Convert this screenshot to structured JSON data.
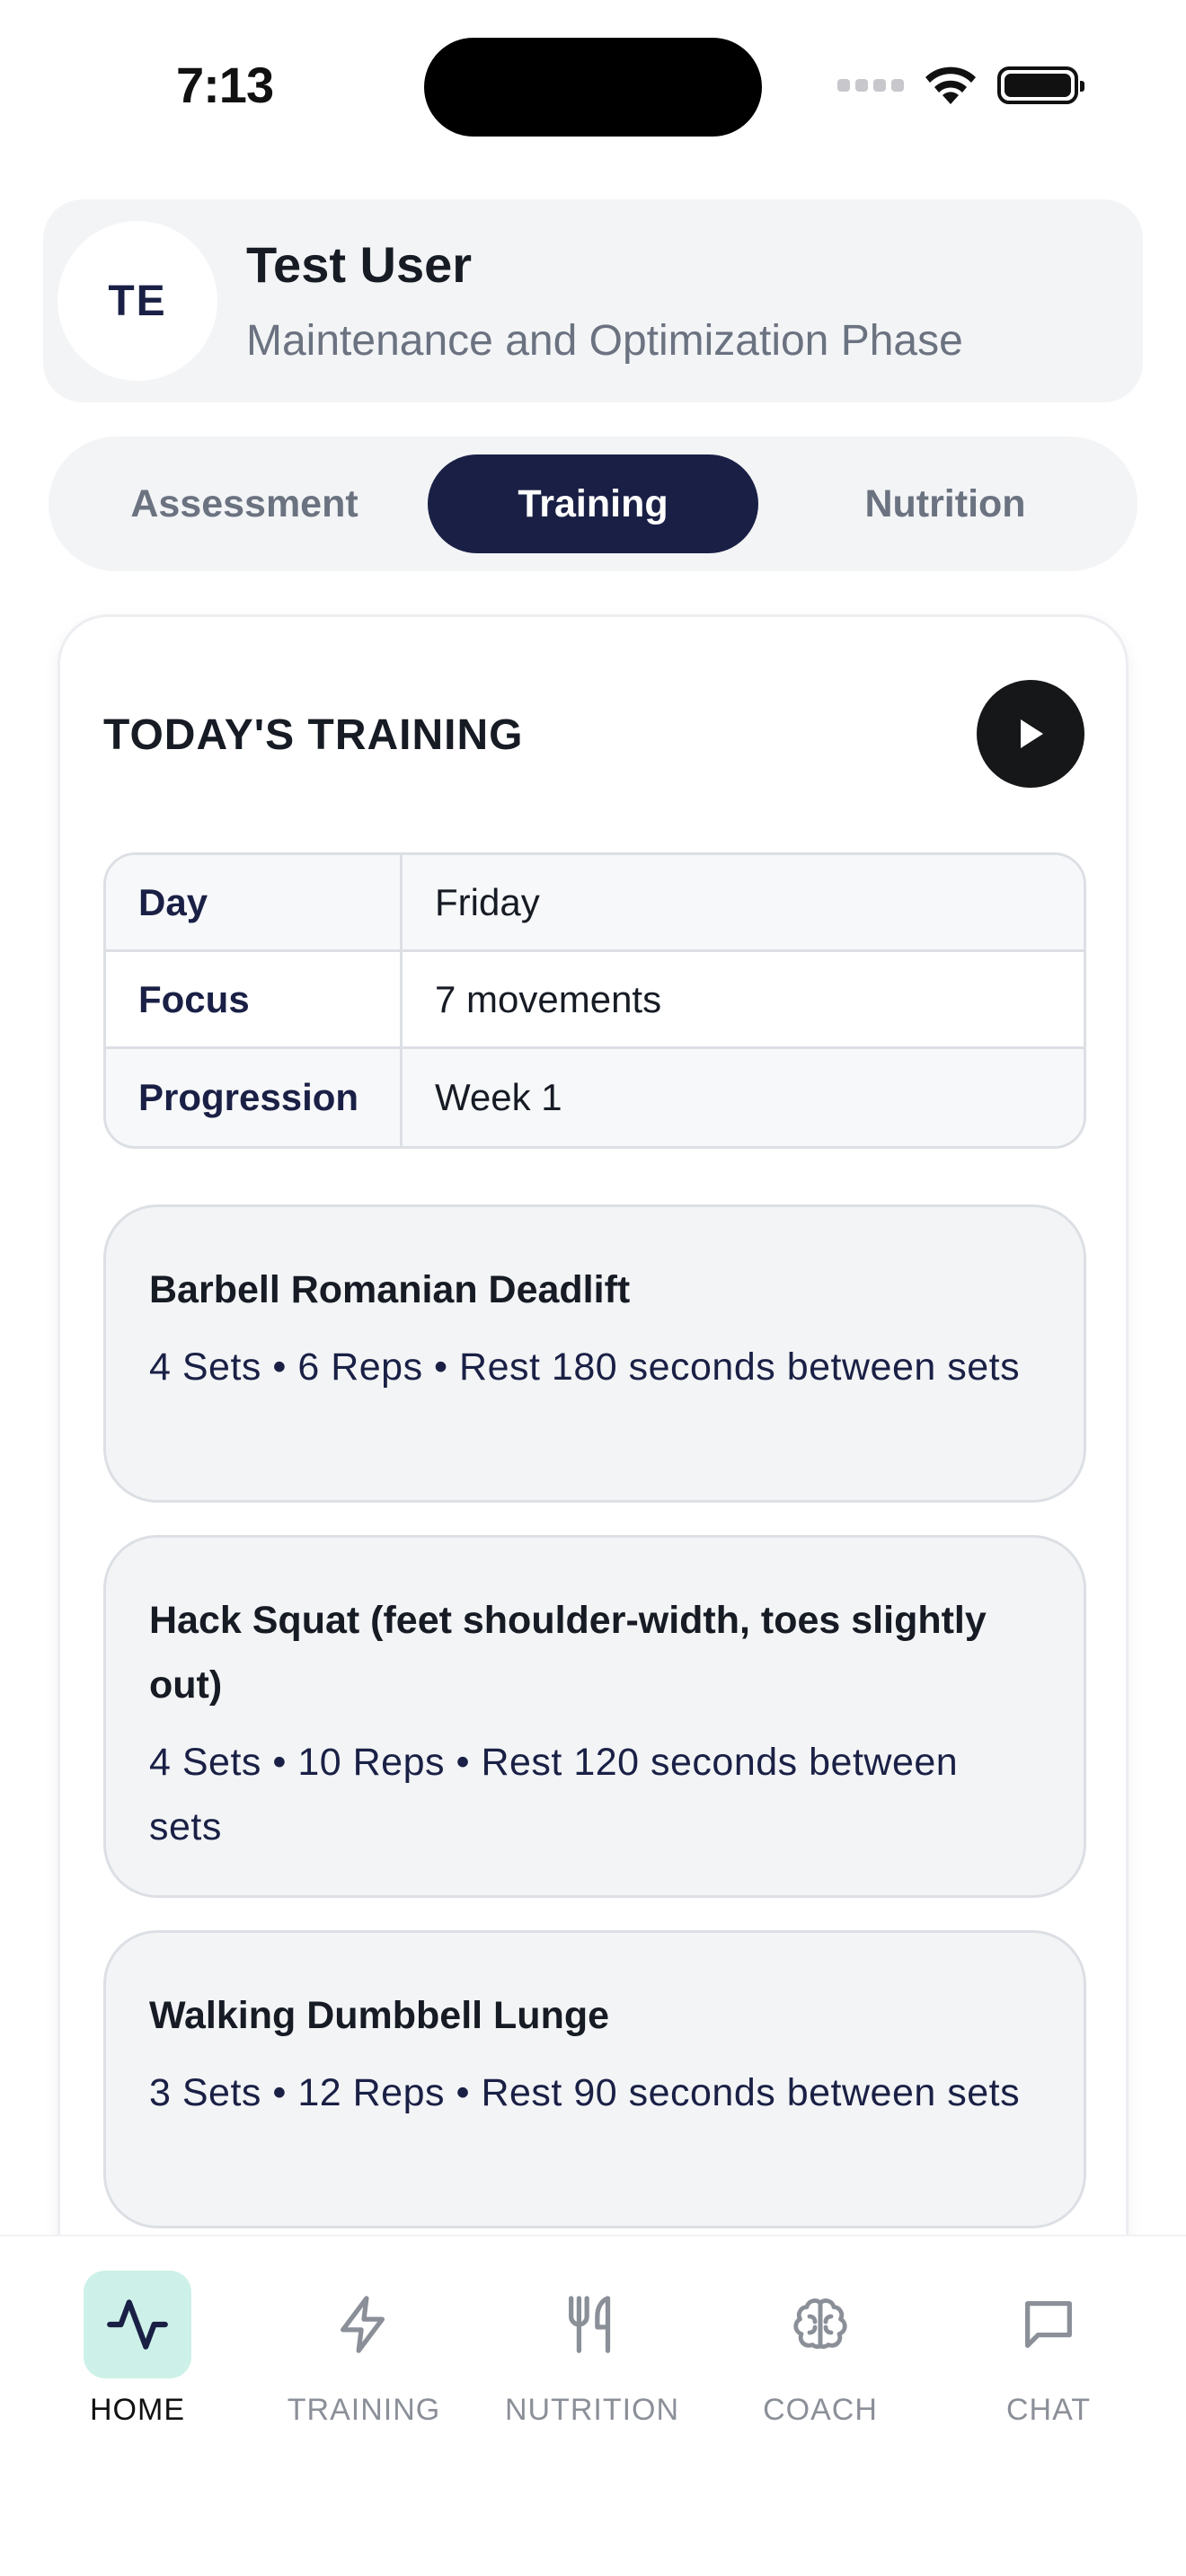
{
  "status_bar": {
    "time": "7:13",
    "icons": [
      "cellular-signal-icon",
      "wifi-icon",
      "battery-icon"
    ]
  },
  "profile": {
    "initials": "TE",
    "name": "Test User",
    "phase": "Maintenance and Optimization Phase"
  },
  "tabs": [
    {
      "label": "Assessment",
      "active": false
    },
    {
      "label": "Training",
      "active": true
    },
    {
      "label": "Nutrition",
      "active": false
    }
  ],
  "training": {
    "title": "TODAY'S TRAINING",
    "play_icon": "play-icon",
    "info": [
      {
        "key": "Day",
        "value": "Friday"
      },
      {
        "key": "Focus",
        "value": "7 movements"
      },
      {
        "key": "Progression",
        "value": "Week 1"
      }
    ],
    "exercises": [
      {
        "name": "Barbell Romanian Deadlift",
        "detail": "4 Sets • 6 Reps • Rest 180 seconds between sets"
      },
      {
        "name": "Hack Squat (feet shoulder-width, toes slightly out)",
        "detail": "4 Sets • 10 Reps • Rest 120 seconds between sets"
      },
      {
        "name": "Walking Dumbbell Lunge",
        "detail": "3 Sets • 12 Reps • Rest 90 seconds between sets"
      }
    ]
  },
  "bottom_nav": [
    {
      "label": "HOME",
      "icon": "activity-icon",
      "active": true
    },
    {
      "label": "TRAINING",
      "icon": "lightning-icon",
      "active": false
    },
    {
      "label": "NUTRITION",
      "icon": "fork-knife-icon",
      "active": false
    },
    {
      "label": "COACH",
      "icon": "brain-icon",
      "active": false
    },
    {
      "label": "CHAT",
      "icon": "chat-bubble-icon",
      "active": false
    }
  ],
  "colors": {
    "accent_navy": "#1a2045",
    "active_nav_bg": "#cdf1e8",
    "card_bg": "#f3f4f6",
    "muted_text": "#6b7280"
  }
}
